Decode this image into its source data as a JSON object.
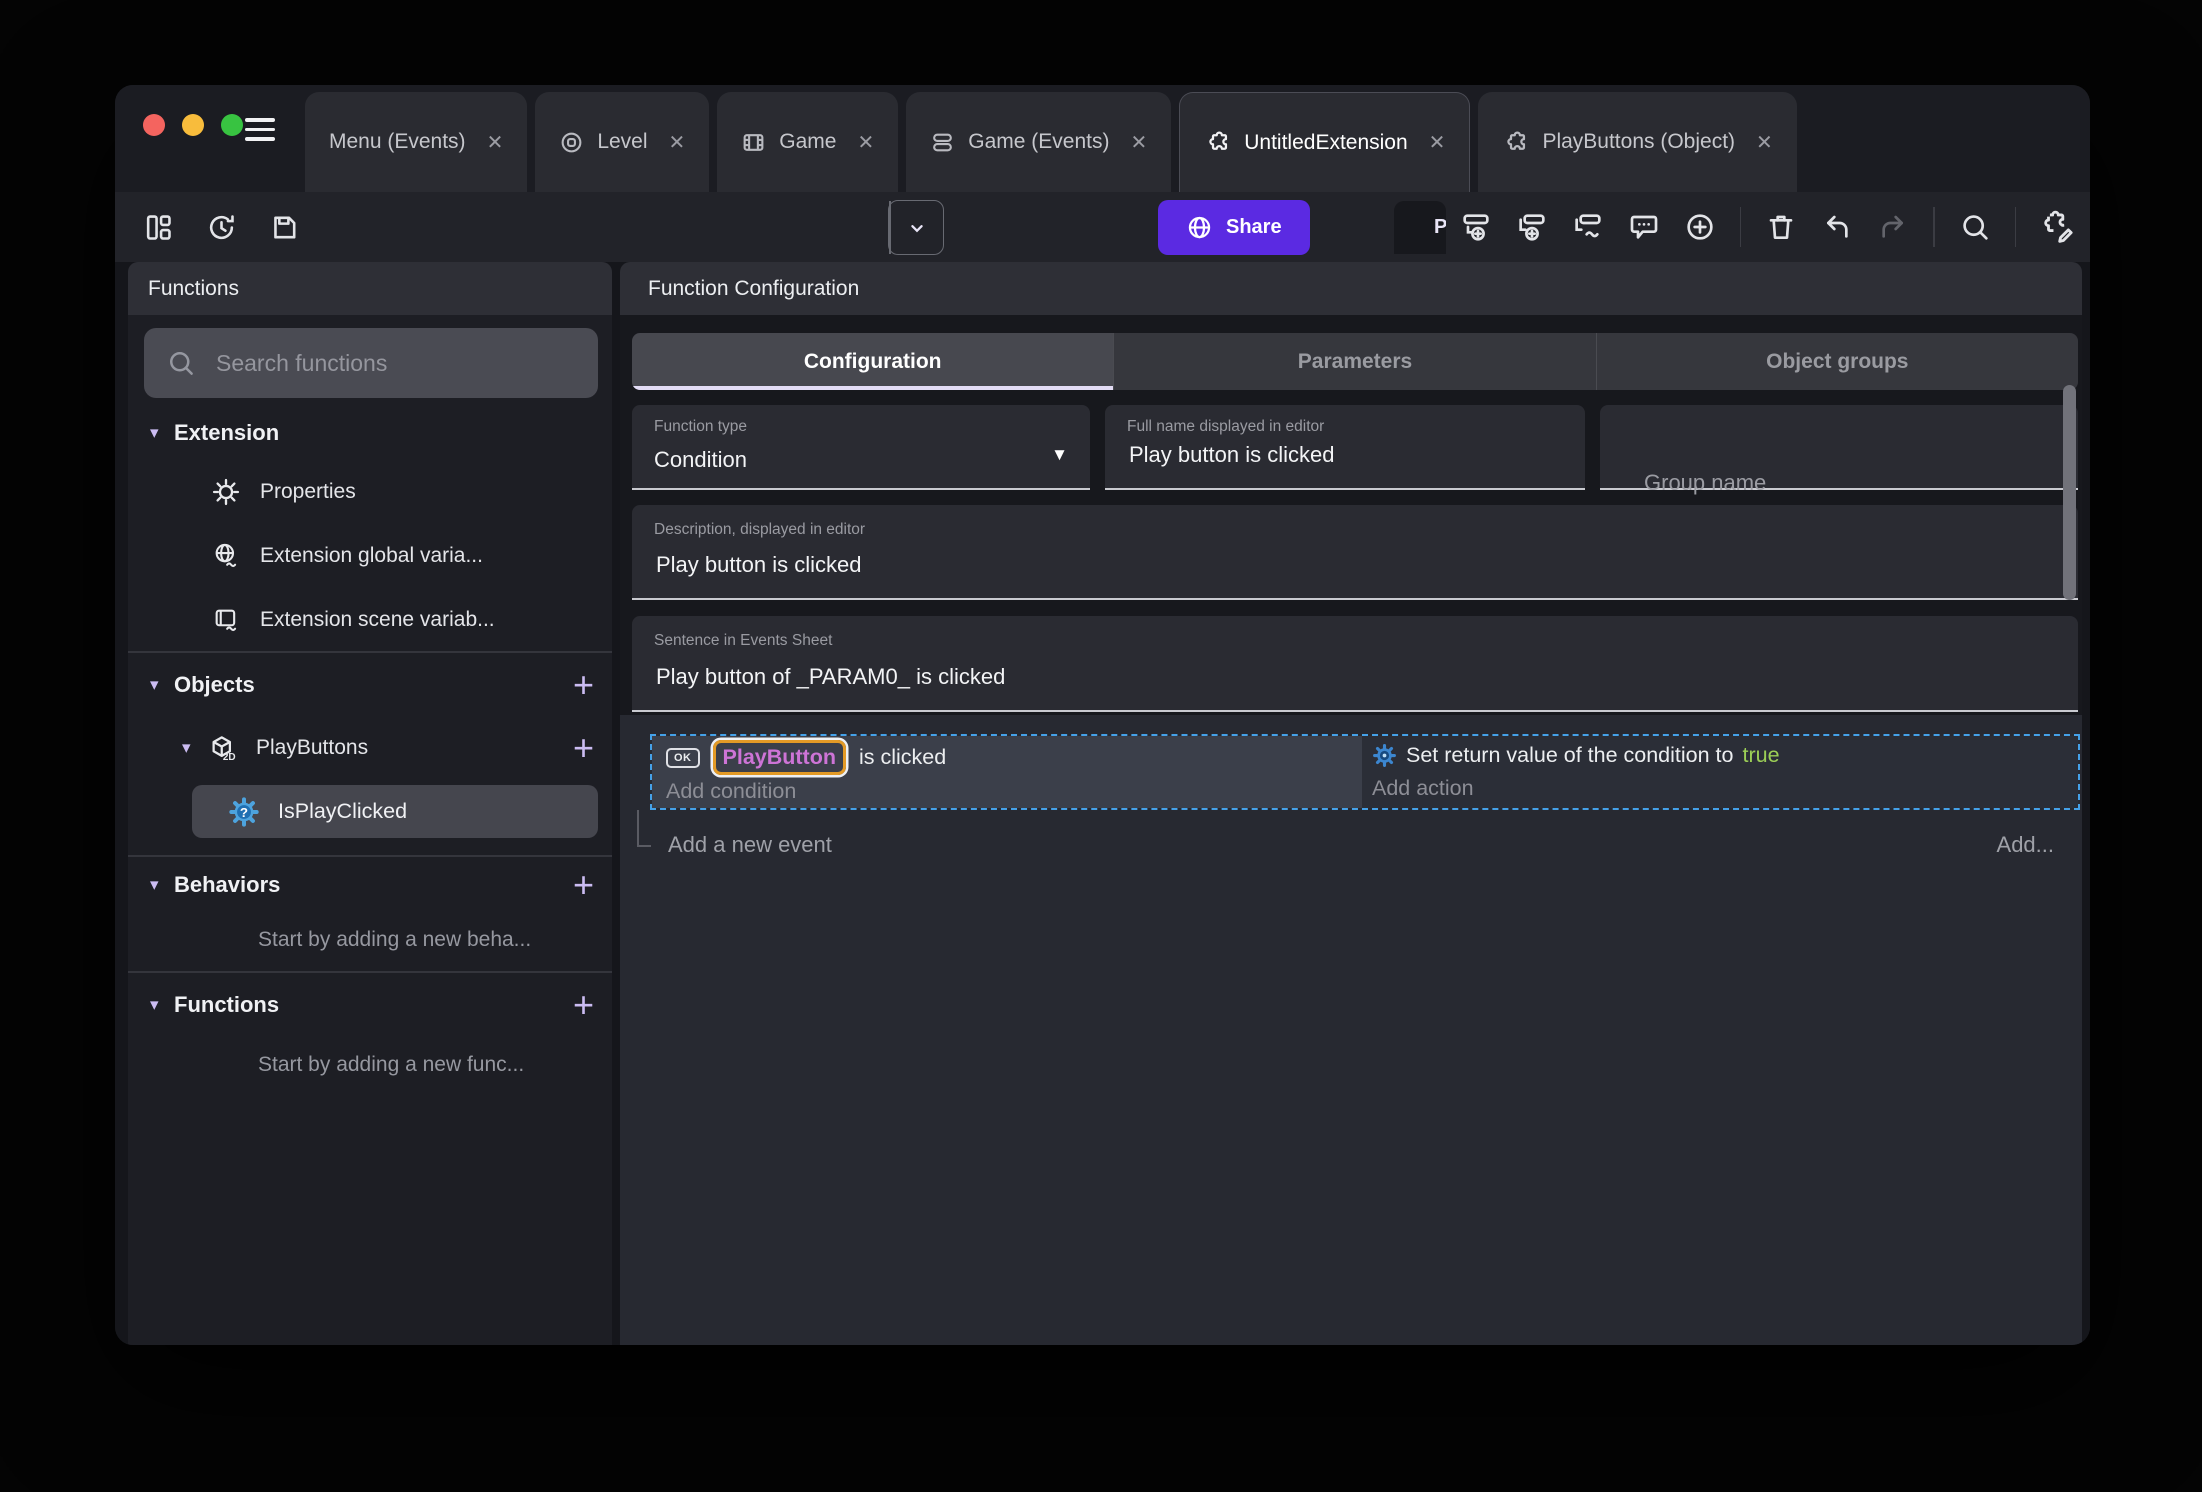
{
  "window": {
    "tabs": [
      {
        "label": "Menu (Events)",
        "close": "✕"
      },
      {
        "label": "Level",
        "icon": "level-icon",
        "close": "✕"
      },
      {
        "label": "Game",
        "icon": "game-icon",
        "close": "✕"
      },
      {
        "label": "Game (Events)",
        "icon": "events-sheet-icon",
        "close": "✕"
      },
      {
        "label": "UntitledExtension",
        "icon": "extension-icon",
        "close": "✕",
        "active": true
      },
      {
        "label": "PlayButtons (Object)",
        "icon": "extension-icon",
        "close": "✕"
      }
    ]
  },
  "toolbar": {
    "left_icons": [
      "layout-icon",
      "history-icon",
      "save-icon"
    ],
    "preview_label": "Preview",
    "share_label": "Share",
    "right_icons": [
      "add-sub-event-icon",
      "add-event-icon",
      "add-wave-event-icon",
      "comment-icon",
      "add-circle-icon",
      "trash-icon",
      "undo-icon",
      "redo-icon",
      "search-icon",
      "edit-extension-icon"
    ]
  },
  "sidebar": {
    "title": "Functions",
    "search_placeholder": "Search functions",
    "extension_section": {
      "label": "Extension",
      "items": [
        {
          "label": "Properties",
          "icon": "gear-icon"
        },
        {
          "label": "Extension global varia...",
          "icon": "globe-variable-icon"
        },
        {
          "label": "Extension scene variab...",
          "icon": "scene-variable-icon"
        }
      ]
    },
    "objects_section": {
      "label": "Objects",
      "add_label": "+",
      "object": {
        "label": "PlayButtons",
        "icon": "cube-2d-icon",
        "add_label": "+",
        "selected_child": {
          "label": "IsPlayClicked",
          "icon": "function-gear-icon"
        }
      }
    },
    "behaviors_section": {
      "label": "Behaviors",
      "add_label": "+",
      "empty_text": "Start by adding a new beha..."
    },
    "functions_section": {
      "label": "Functions",
      "add_label": "+",
      "empty_text": "Start by adding a new func..."
    }
  },
  "main": {
    "title": "Function Configuration",
    "tabs": [
      {
        "label": "Configuration",
        "active": true
      },
      {
        "label": "Parameters",
        "active": false
      },
      {
        "label": "Object groups",
        "active": false
      }
    ],
    "fields": {
      "function_type": {
        "label": "Function type",
        "value": "Condition"
      },
      "full_name": {
        "label": "Full name displayed in editor",
        "value": "Play button is clicked"
      },
      "group_name": {
        "placeholder": "Group name"
      },
      "description": {
        "label": "Description, displayed in editor",
        "value": "Play button is clicked"
      },
      "sentence": {
        "label": "Sentence in Events Sheet",
        "value": "Play button of _PARAM0_ is clicked"
      }
    },
    "events_sheet": {
      "condition": {
        "badge": "OK",
        "object_name": "PlayButton",
        "suffix": "is clicked",
        "add_label": "Add condition"
      },
      "action": {
        "prefix": "Set return value of the condition to",
        "value": "true",
        "add_label": "Add action"
      },
      "add_event_label": "Add a new event",
      "add_button_label": "Add..."
    }
  },
  "colors": {
    "share_purple": "#5b2ae2",
    "selection_blue": "#45a1e8",
    "object_purple": "#cd74d6",
    "object_highlight_orange": "#e39a26",
    "boolean_true_green": "#9ccf56"
  }
}
